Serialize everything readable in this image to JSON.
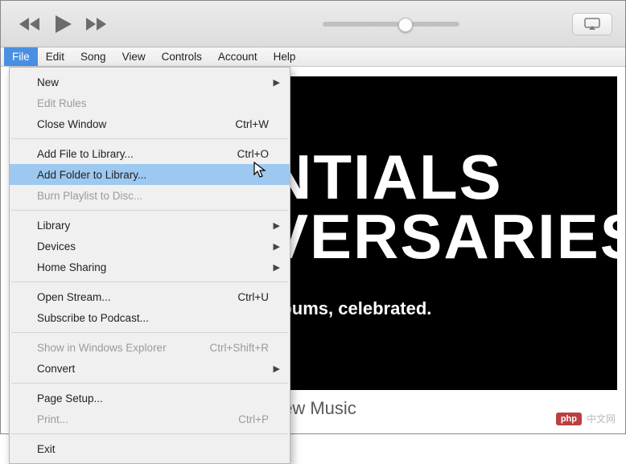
{
  "menubar": [
    "File",
    "Edit",
    "Song",
    "View",
    "Controls",
    "Account",
    "Help"
  ],
  "active_menu_index": 0,
  "dropdown": {
    "groups": [
      [
        {
          "label": "New",
          "submenu": true
        },
        {
          "label": "Edit Rules",
          "disabled": true
        },
        {
          "label": "Close Window",
          "shortcut": "Ctrl+W"
        }
      ],
      [
        {
          "label": "Add File to Library...",
          "shortcut": "Ctrl+O"
        },
        {
          "label": "Add Folder to Library...",
          "highlight": true
        },
        {
          "label": "Burn Playlist to Disc...",
          "disabled": true
        }
      ],
      [
        {
          "label": "Library",
          "submenu": true
        },
        {
          "label": "Devices",
          "submenu": true
        },
        {
          "label": "Home Sharing",
          "submenu": true
        }
      ],
      [
        {
          "label": "Open Stream...",
          "shortcut": "Ctrl+U"
        },
        {
          "label": "Subscribe to Podcast..."
        }
      ],
      [
        {
          "label": "Show in Windows Explorer",
          "shortcut": "Ctrl+Shift+R",
          "disabled": true
        },
        {
          "label": "Convert",
          "submenu": true
        }
      ],
      [
        {
          "label": "Page Setup..."
        },
        {
          "label": "Print...",
          "shortcut": "Ctrl+P",
          "disabled": true
        }
      ],
      [
        {
          "label": "Exit"
        }
      ]
    ]
  },
  "hero": {
    "line1": "NTIALS",
    "line2": "VERSARIES",
    "tagline": "albums, celebrated."
  },
  "section_title": "New Music",
  "watermark": {
    "badge": "php",
    "text": "中文网"
  }
}
